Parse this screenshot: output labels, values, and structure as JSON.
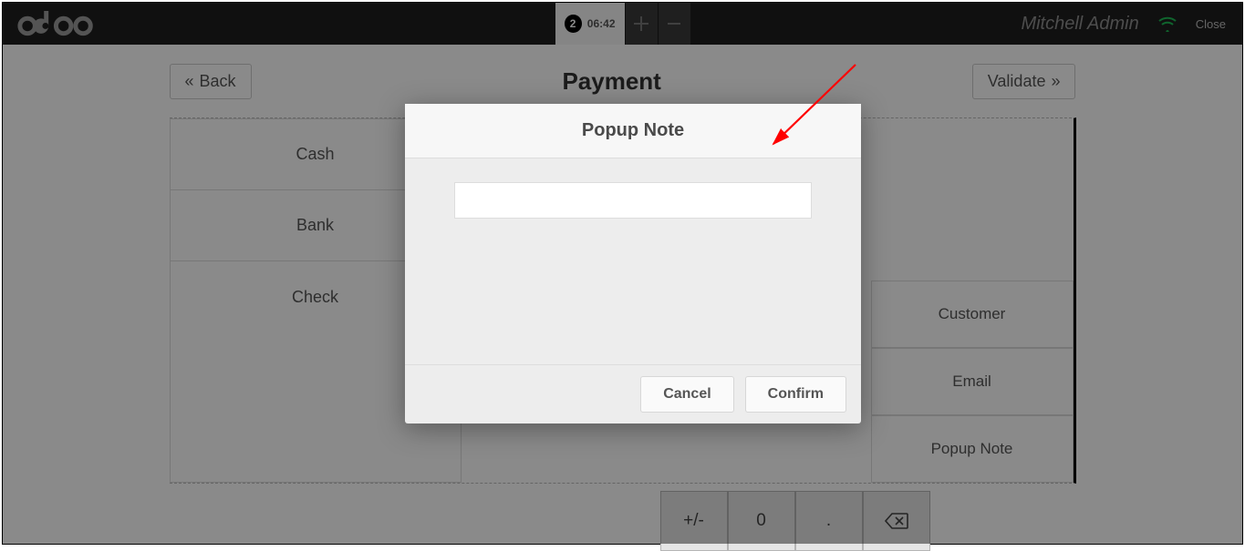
{
  "topbar": {
    "logo_text": "odoo",
    "tab_badge": "2",
    "tab_time": "06:42",
    "username": "Mitchell Admin",
    "close_label": "Close"
  },
  "payment": {
    "title": "Payment",
    "back_label": "Back",
    "validate_label": "Validate",
    "methods": [
      "Cash",
      "Bank",
      "Check"
    ],
    "right_buttons": [
      "Customer",
      "Email",
      "Popup Note"
    ],
    "keypad": [
      "+/-",
      "0",
      ".",
      "⌫"
    ]
  },
  "popup": {
    "title": "Popup Note",
    "input_value": "",
    "cancel_label": "Cancel",
    "confirm_label": "Confirm"
  }
}
